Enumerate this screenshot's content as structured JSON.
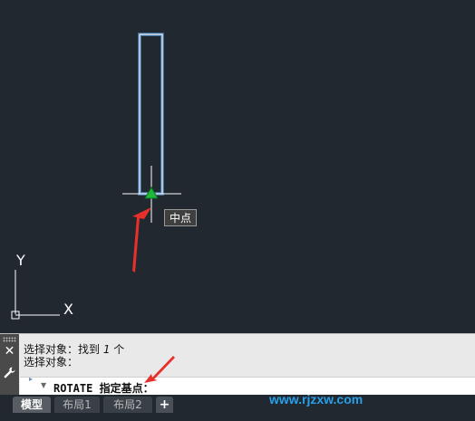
{
  "canvas": {
    "background": "#212830",
    "object_color": "#ffffff",
    "highlight_color": "#5aa9ff",
    "snap_marker_color": "#1fb83a",
    "annotation_color": "#e8302a",
    "ucs_icon": {
      "y_label": "Y",
      "x_label": "X"
    }
  },
  "tooltip": {
    "text": "中点"
  },
  "command_line": {
    "history": [
      {
        "prefix": "选择对象：找到 ",
        "number": "1",
        "suffix": " 个"
      },
      {
        "text": "选择对象："
      }
    ],
    "input": {
      "text": "ROTATE 指定基点："
    }
  },
  "tabs": [
    {
      "label": "模型",
      "active": true
    },
    {
      "label": "布局1",
      "active": false
    },
    {
      "label": "布局2",
      "active": false
    }
  ],
  "add_tab_label": "+",
  "watermark": {
    "text": "www.rjzxw.com"
  }
}
